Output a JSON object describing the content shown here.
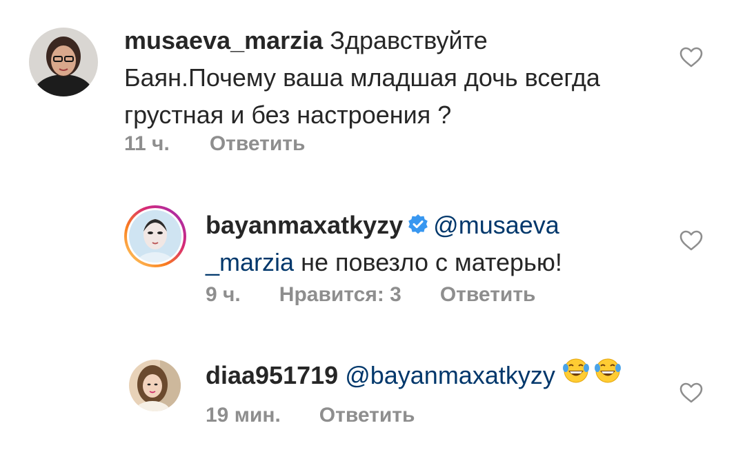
{
  "comments": [
    {
      "username": "musaeva_marzia",
      "text": "Здравствуйте Баян.Почему ваша младшая дочь всегда грустная и без настроения ?",
      "line1": "Здравствуйте",
      "line2": "Баян.Почему ваша младшая дочь всегда",
      "line3": "грустная и без настроения ?",
      "time": "11 ч.",
      "reply": "Ответить",
      "avatar_icon": "profile-photo-woman-glasses"
    },
    {
      "username": "bayanmaxatkyzy",
      "verified": true,
      "mention_part1": "@musaeva",
      "mention_part2": "_marzia",
      "text_after": "не повезло с матерью!",
      "time": "9 ч.",
      "likes": "Нравится: 3",
      "reply": "Ответить",
      "avatar_icon": "profile-photo-story-ring"
    },
    {
      "username": "diaa951719",
      "mention": "@bayanmaxatkyzy",
      "emoji": "😂😂",
      "time": "19 мин.",
      "reply": "Ответить",
      "avatar_icon": "profile-photo-woman"
    }
  ],
  "colors": {
    "text": "#262626",
    "meta": "#8e8e8e",
    "mention": "#00376b",
    "verified": "#3897f0"
  }
}
